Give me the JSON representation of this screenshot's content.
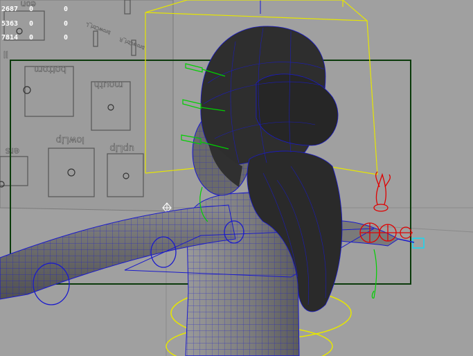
{
  "hud": {
    "rows": [
      {
        "a": "2687",
        "b": "0",
        "c": "0"
      },
      {
        "a": "5363",
        "b": "0",
        "c": "0"
      },
      {
        "a": "7814",
        "b": "0",
        "c": "0"
      }
    ],
    "partial_label": "eon"
  },
  "control_board": {
    "labels": {
      "mouth": "mouth",
      "bottom": "bottom",
      "lowLip": "lowLip",
      "upLip": "upLip",
      "ers": "ers",
      "ll": "ll",
      "brow_1": "browCtrl_L",
      "brow_2": "browCtrl_R"
    }
  },
  "colors": {
    "viewport_bg": "#a0a0a0",
    "hair": "#2e2e2e",
    "wire": "#1a1acc",
    "bbox": "#e6e600",
    "camera_frame": "#0b3a0b",
    "rig_red": "#e00000",
    "rig_green": "#00d000",
    "rig_cyan": "#00e0ff"
  }
}
